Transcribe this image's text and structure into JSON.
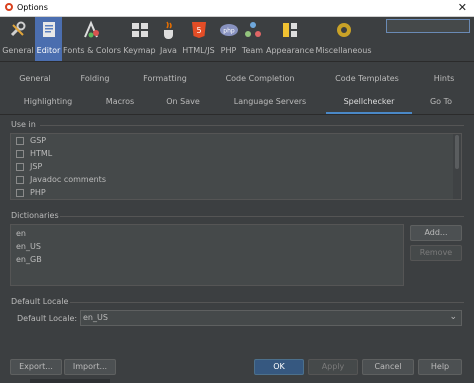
{
  "window": {
    "title": "Options",
    "close_glyph": "✕"
  },
  "toolbar": {
    "items": [
      {
        "label": "General",
        "icon": "wrench-icon"
      },
      {
        "label": "Editor",
        "icon": "editor-icon",
        "active": true
      },
      {
        "label": "Fonts & Colors",
        "icon": "fonts-colors-icon"
      },
      {
        "label": "Keymap",
        "icon": "keymap-icon"
      },
      {
        "label": "Java",
        "icon": "java-icon"
      },
      {
        "label": "HTML/JS",
        "icon": "html5-icon"
      },
      {
        "label": "PHP",
        "icon": "php-icon"
      },
      {
        "label": "Team",
        "icon": "team-icon"
      },
      {
        "label": "Appearance",
        "icon": "appearance-icon"
      },
      {
        "label": "Miscellaneous",
        "icon": "miscellaneous-icon"
      }
    ],
    "search_placeholder": ""
  },
  "tabs_row1": [
    "General",
    "Folding",
    "Formatting",
    "Code Completion",
    "Code Templates",
    "Hints"
  ],
  "tabs_row2": [
    "Highlighting",
    "Macros",
    "On Save",
    "Language Servers",
    "Spellchecker",
    "Go To"
  ],
  "active_tab": "Spellchecker",
  "use_in": {
    "label": "Use in",
    "items": [
      "GSP",
      "HTML",
      "JSP",
      "Javadoc comments",
      "PHP"
    ]
  },
  "dictionaries": {
    "label": "Dictionaries",
    "items": [
      "en",
      "en_US",
      "en_GB"
    ],
    "add_label": "Add...",
    "remove_label": "Remove"
  },
  "default_locale": {
    "section_label": "Default Locale",
    "field_label": "Default Locale:",
    "value": "en_US"
  },
  "footer": {
    "export_label": "Export...",
    "import_label": "Import...",
    "ok_label": "OK",
    "apply_label": "Apply",
    "cancel_label": "Cancel",
    "help_label": "Help"
  },
  "colors": {
    "accent": "#4b6eaf",
    "background": "#3c3f41",
    "field": "#45494a",
    "tab_underline": "#4a88c7"
  }
}
